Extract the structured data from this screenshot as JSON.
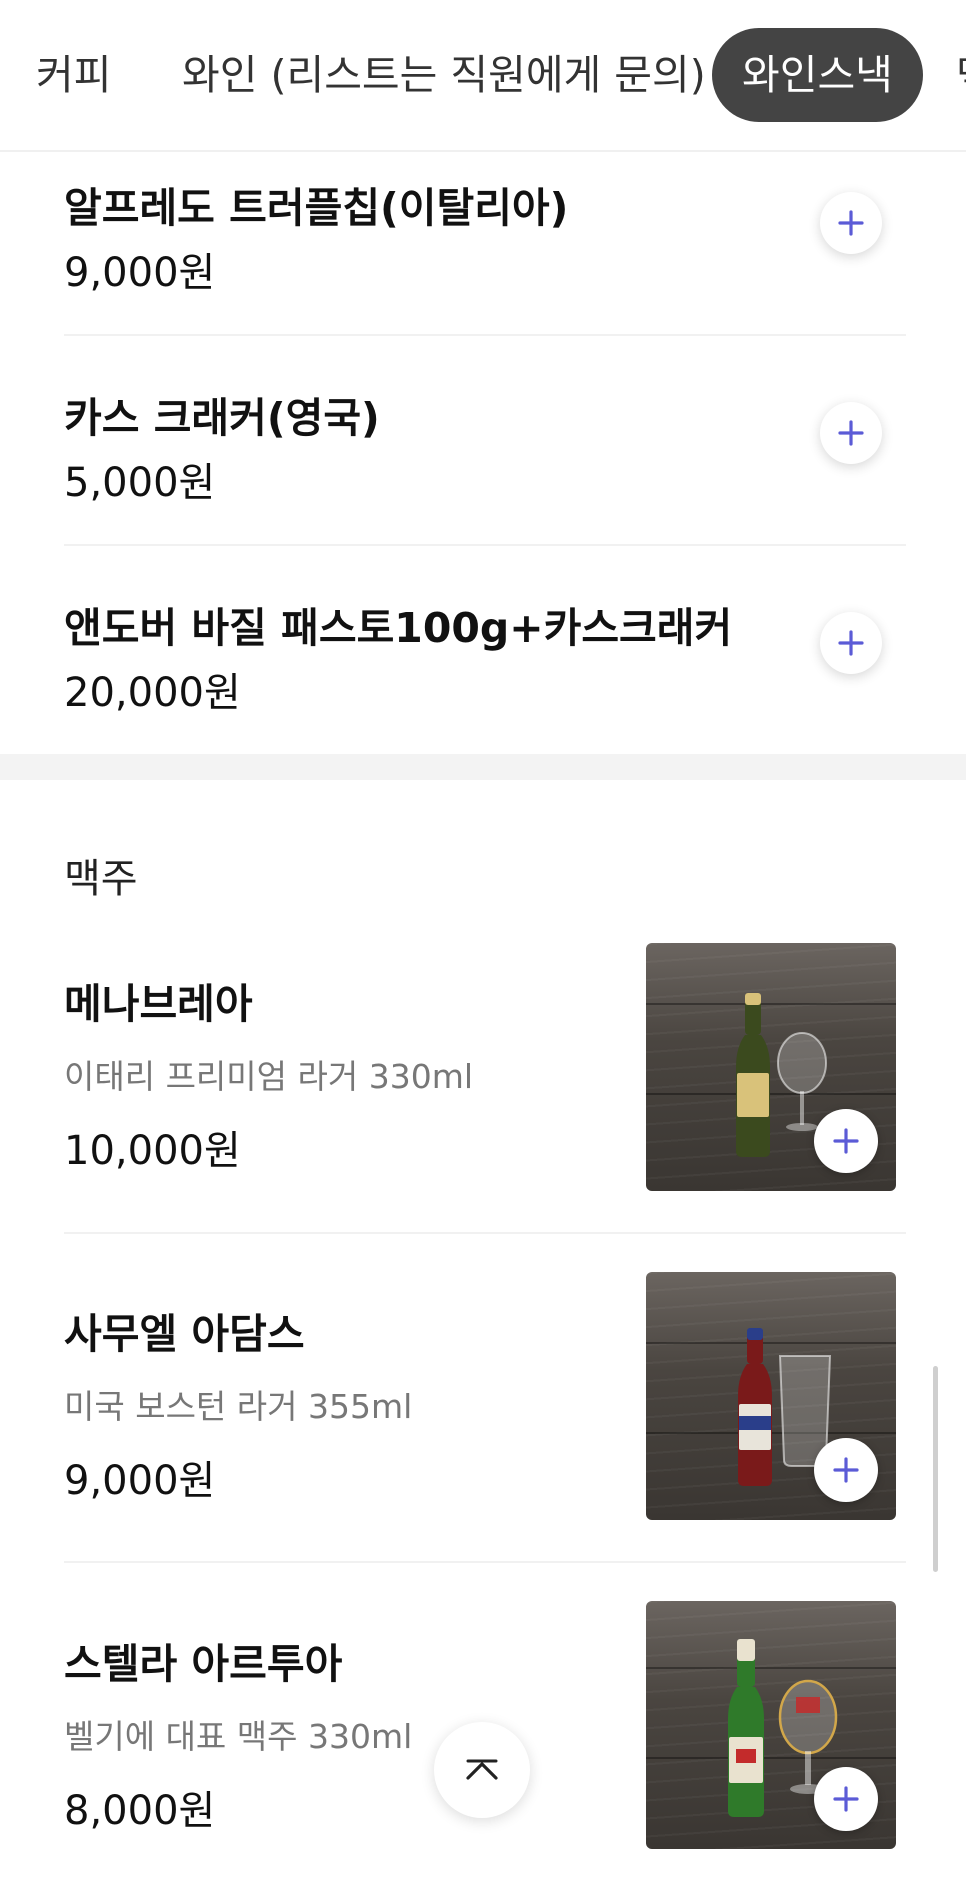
{
  "tabs": [
    {
      "label": "커피"
    },
    {
      "label": "와인 (리스트는 직원에게 문의)"
    },
    {
      "label": "와인스낵",
      "active": true
    },
    {
      "label": "맥"
    }
  ],
  "snacks": [
    {
      "name": "알프레도 트러플칩(이탈리아)",
      "price": "9,000원"
    },
    {
      "name": "카스 크래커(영국)",
      "price": "5,000원"
    },
    {
      "name": "앤도버 바질 패스토100g+카스크래커",
      "price": "20,000원"
    }
  ],
  "beer_section": {
    "title": "맥주",
    "items": [
      {
        "name": "메나브레아",
        "desc": "이태리 프리미엄 라거 330ml",
        "price": "10,000원",
        "bottle_color": "#3b4a1e",
        "label_color": "#d9c27a"
      },
      {
        "name": "사무엘 아담스",
        "desc": "미국 보스턴 라거 355ml",
        "price": "9,000원",
        "bottle_color": "#7a1a1a",
        "label_color": "#2a3e8a"
      },
      {
        "name": "스텔라 아르투아",
        "desc": "벨기에 대표 맥주 330ml",
        "price": "8,000원",
        "bottle_color": "#2f7a2a",
        "label_color": "#e9e2cf"
      }
    ]
  },
  "icons": {
    "add": "plus-icon",
    "scroll_top": "chevron-up-icon"
  },
  "colors": {
    "accent": "#5b5bd6",
    "active_tab_bg": "#444444"
  }
}
